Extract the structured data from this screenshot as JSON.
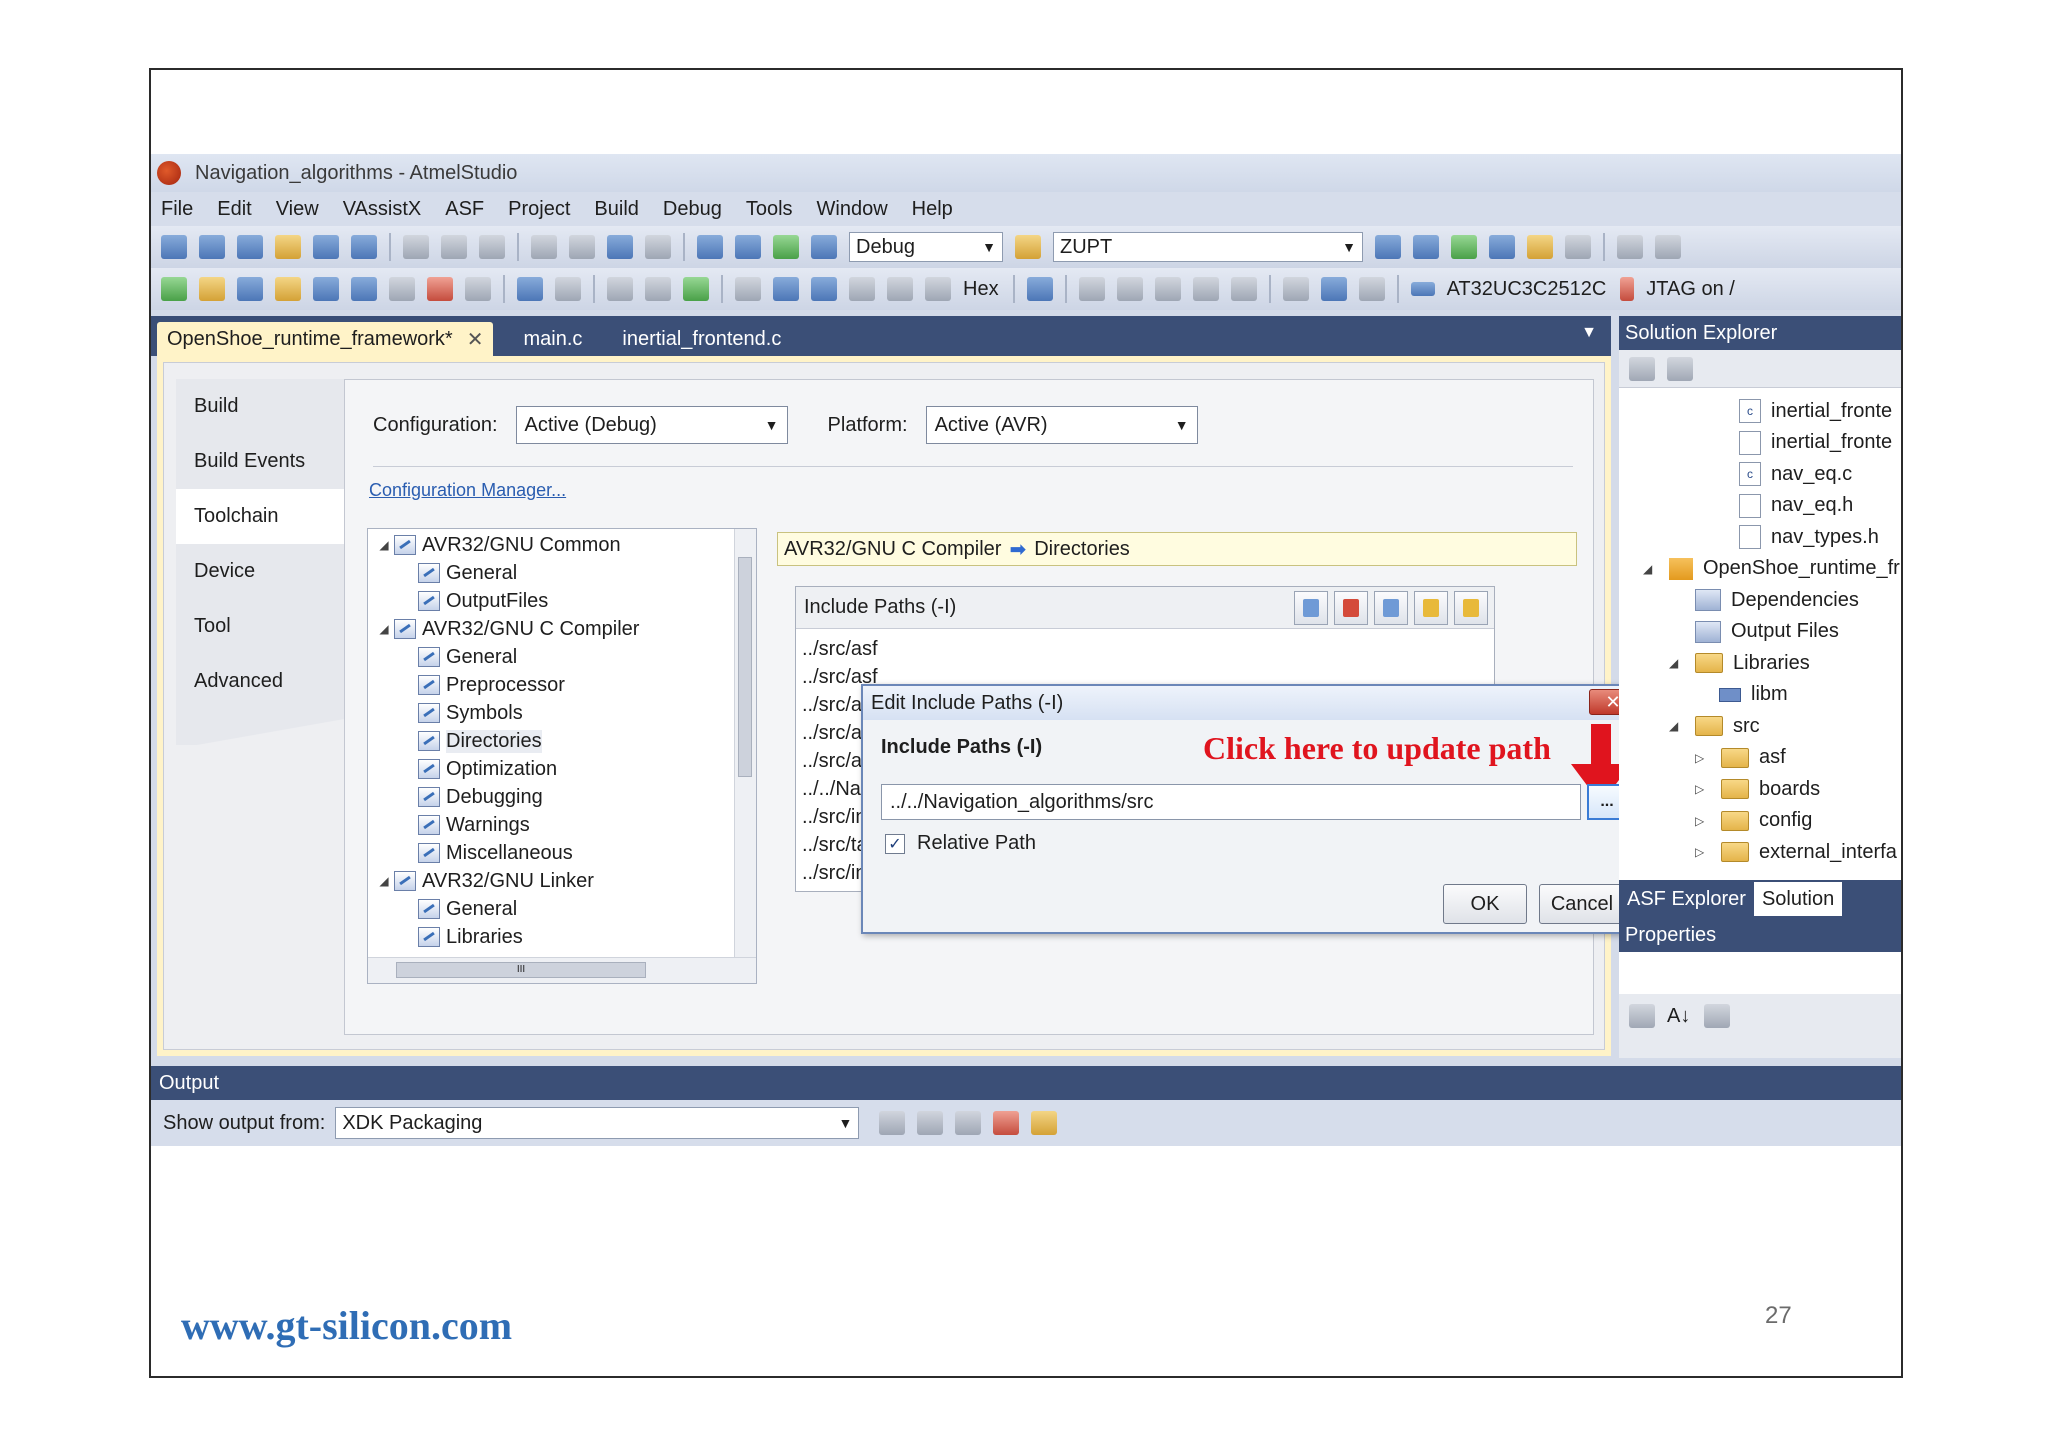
{
  "window": {
    "title": "Navigation_algorithms - AtmelStudio"
  },
  "menu": [
    "File",
    "Edit",
    "View",
    "VAssistX",
    "ASF",
    "Project",
    "Build",
    "Debug",
    "Tools",
    "Window",
    "Help"
  ],
  "toolbar": {
    "config_combo": "Debug",
    "target_combo": "ZUPT",
    "hex_label": "Hex",
    "device_label": "AT32UC3C2512C",
    "tool_label": "JTAG on /"
  },
  "doc_tabs": [
    {
      "label": "OpenShoe_runtime_framework*",
      "close": "✕"
    },
    {
      "label": "main.c"
    },
    {
      "label": "inertial_frontend.c"
    }
  ],
  "side_tabs": [
    "Build",
    "Build Events",
    "Toolchain",
    "Device",
    "Tool",
    "Advanced"
  ],
  "config": {
    "configuration_label": "Configuration:",
    "configuration_value": "Active (Debug)",
    "platform_label": "Platform:",
    "platform_value": "Active (AVR)",
    "manager_link": "Configuration Manager..."
  },
  "tree": [
    {
      "label": "AVR32/GNU Common",
      "level": 0,
      "toggle": "◢"
    },
    {
      "label": "General",
      "level": 1
    },
    {
      "label": "OutputFiles",
      "level": 1
    },
    {
      "label": "AVR32/GNU C Compiler",
      "level": 0,
      "toggle": "◢"
    },
    {
      "label": "General",
      "level": 1
    },
    {
      "label": "Preprocessor",
      "level": 1
    },
    {
      "label": "Symbols",
      "level": 1
    },
    {
      "label": "Directories",
      "level": 1
    },
    {
      "label": "Optimization",
      "level": 1
    },
    {
      "label": "Debugging",
      "level": 1
    },
    {
      "label": "Warnings",
      "level": 1
    },
    {
      "label": "Miscellaneous",
      "level": 1
    },
    {
      "label": "AVR32/GNU Linker",
      "level": 0,
      "toggle": "◢"
    },
    {
      "label": "General",
      "level": 1
    },
    {
      "label": "Libraries",
      "level": 1
    }
  ],
  "tree_scroll_grip": "III",
  "breadcrumb": {
    "section": "AVR32/GNU C Compiler",
    "arrow": "➡",
    "page": "Directories"
  },
  "include_box": {
    "header": "Include Paths (-I)",
    "paths": [
      "../src/asf",
      "../src/asf",
      "../src/asf",
      "../src/asf",
      "../src/asf",
      "../../Navi",
      "../src/int",
      "../src/tab",
      "../src/int"
    ]
  },
  "dialog": {
    "title": "Edit Include Paths (-I)",
    "close": "✕",
    "heading": "Include Paths (-I)",
    "annotation": "Click here to update path",
    "path_value": "../../Navigation_algorithms/src",
    "browse_label": "...",
    "relative_check": "✓",
    "relative_label": "Relative Path",
    "ok": "OK",
    "cancel": "Cancel"
  },
  "solution_explorer": {
    "title": "Solution Explorer",
    "items": [
      {
        "label": "inertial_fronte",
        "icon": "c-file",
        "badge": "c"
      },
      {
        "label": "inertial_fronte",
        "icon": "h-file"
      },
      {
        "label": "nav_eq.c",
        "icon": "c-file",
        "badge": "c"
      },
      {
        "label": "nav_eq.h",
        "icon": "h-file"
      },
      {
        "label": "nav_types.h",
        "icon": "h-file"
      },
      {
        "label": "OpenShoe_runtime_fr",
        "icon": "project",
        "toggle": "◢"
      },
      {
        "label": "Dependencies",
        "icon": "dep"
      },
      {
        "label": "Output Files",
        "icon": "dep"
      },
      {
        "label": "Libraries",
        "icon": "folder",
        "toggle": "◢"
      },
      {
        "label": "libm",
        "icon": "ref"
      },
      {
        "label": "src",
        "icon": "folder",
        "toggle": "◢"
      },
      {
        "label": "asf",
        "icon": "folder",
        "toggle": "▷"
      },
      {
        "label": "boards",
        "icon": "folder",
        "toggle": "▷"
      },
      {
        "label": "config",
        "icon": "folder",
        "toggle": "▷"
      },
      {
        "label": "external_interfa",
        "icon": "folder",
        "toggle": "▷"
      }
    ],
    "bottom_tabs": [
      "ASF Explorer",
      "Solution"
    ]
  },
  "properties": {
    "title": "Properties",
    "sort_label": "A↓"
  },
  "output": {
    "title": "Output",
    "show_from_label": "Show output from:",
    "show_from_value": "XDK Packaging"
  },
  "slide": {
    "footer_url": "www.gt-silicon.com",
    "page_number": "27"
  },
  "colors": {
    "accent_title": "#3b4f77",
    "active_tab": "#fff3c8",
    "annotation_red": "#e0141e",
    "footer_blue": "#2f6db5"
  }
}
